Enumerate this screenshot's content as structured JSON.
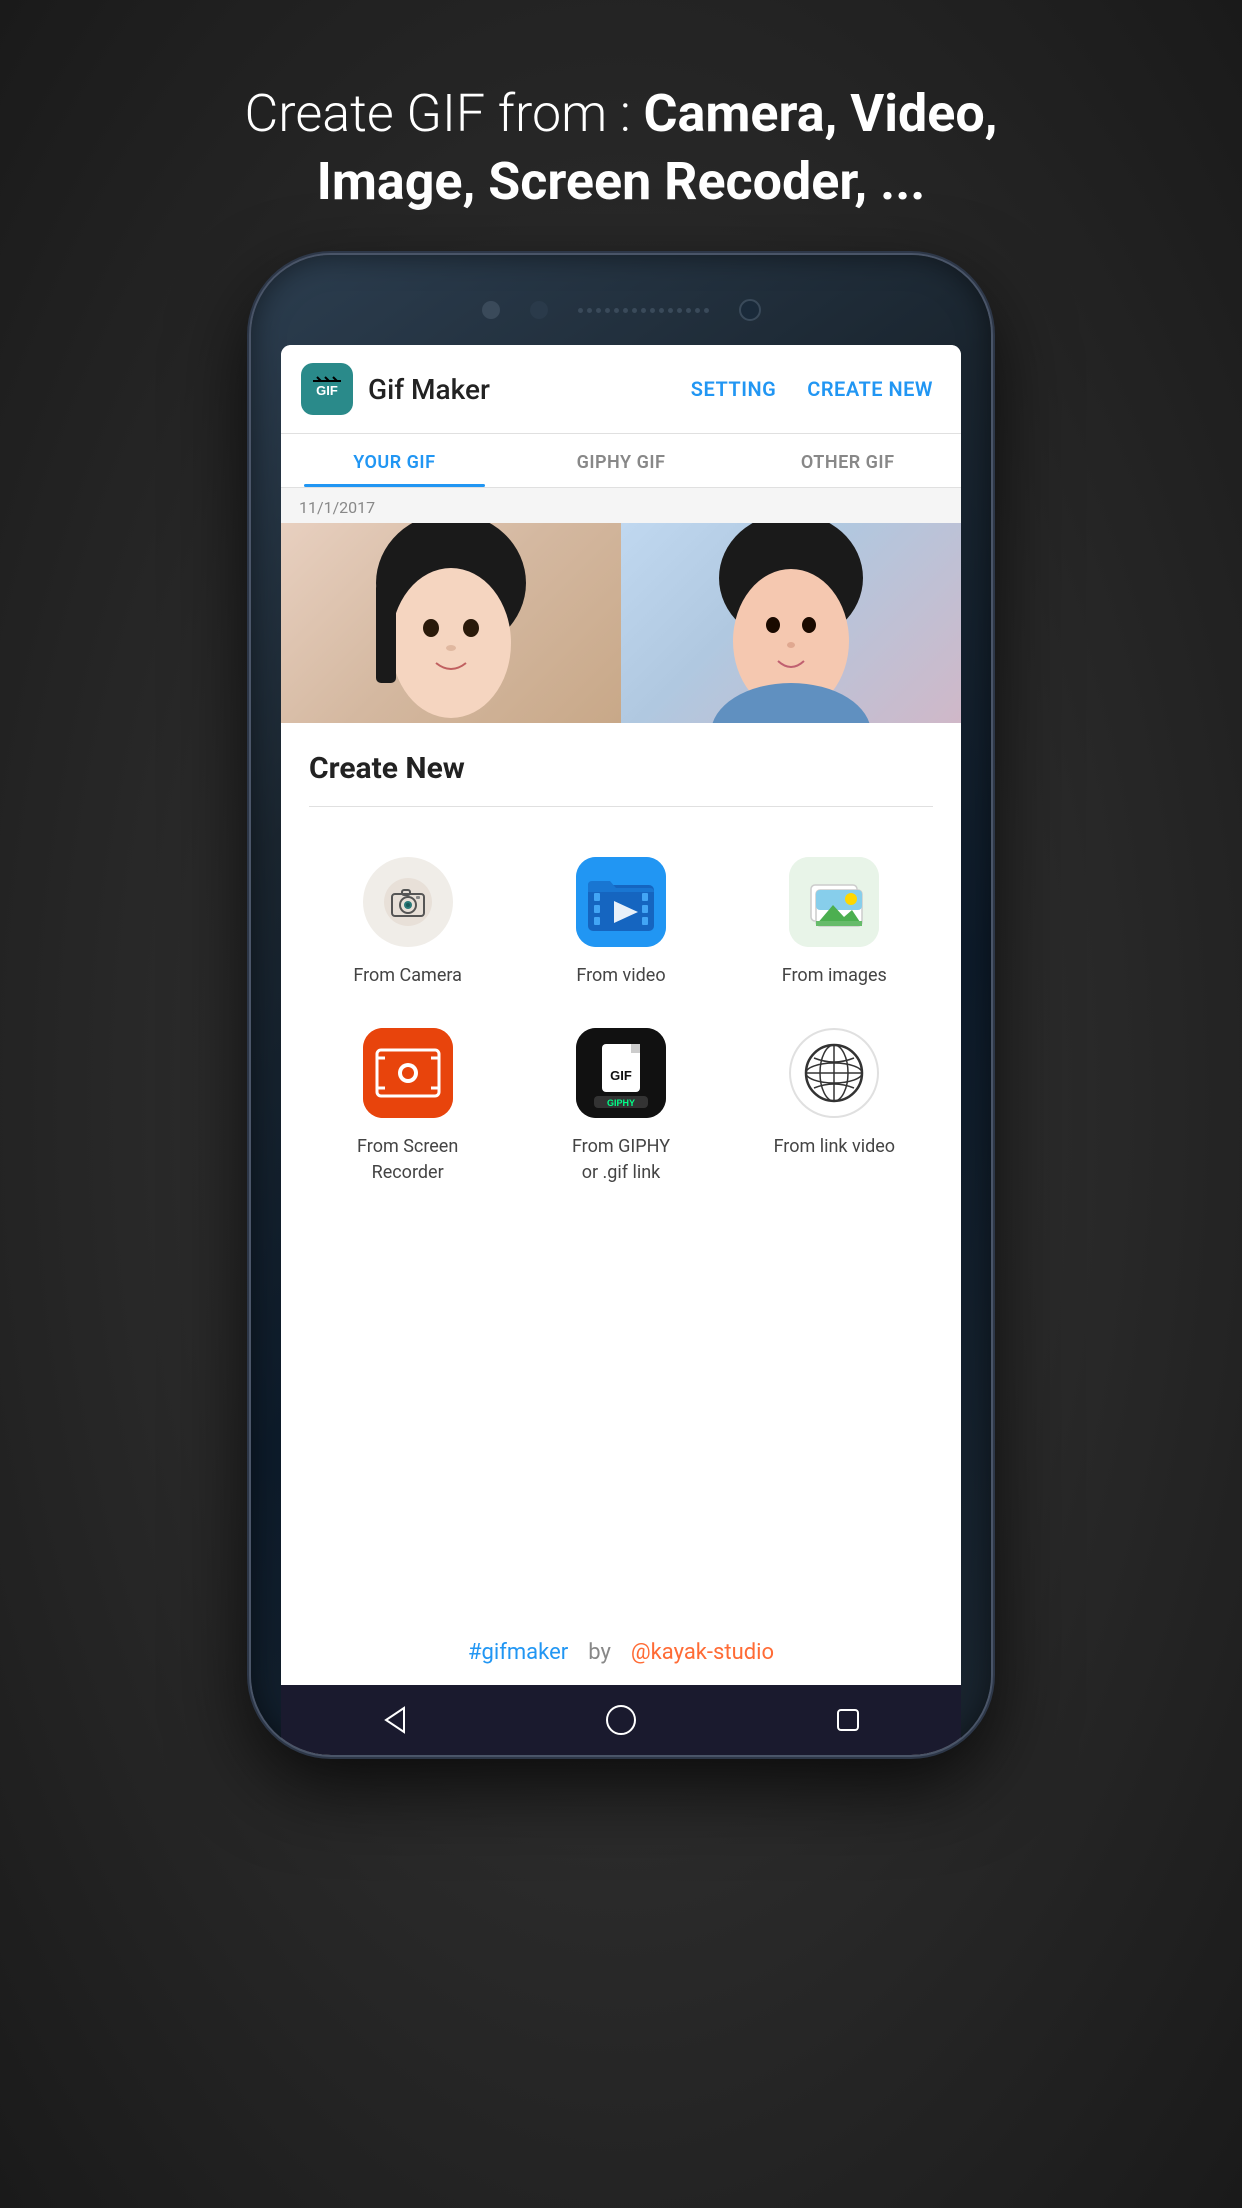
{
  "headline": {
    "part1": "Create GIF from : ",
    "part2": "Camera, Video,",
    "part3": "Image, Screen Recoder, ..."
  },
  "app": {
    "icon_text": "GIF",
    "title": "Gif Maker",
    "setting_btn": "SETTING",
    "create_new_btn": "CREATE NEW",
    "tabs": [
      {
        "label": "YOUR GIF",
        "active": true
      },
      {
        "label": "GIPHY GIF",
        "active": false
      },
      {
        "label": "OTHER GIF",
        "active": false
      }
    ],
    "date_label": "11/1/2017"
  },
  "bottom_sheet": {
    "title": "Create New",
    "items": [
      {
        "id": "camera",
        "label": "From Camera"
      },
      {
        "id": "video",
        "label": "From video"
      },
      {
        "id": "images",
        "label": "From images"
      },
      {
        "id": "screen-recorder",
        "label": "From Screen\nRecorder"
      },
      {
        "id": "giphy",
        "label": "From GIPHY\nor .gif link"
      },
      {
        "id": "link-video",
        "label": "From link video"
      }
    ]
  },
  "footer": {
    "hashtag": "#gifmaker",
    "by": "by",
    "studio": "@kayak-studio"
  },
  "nav": {
    "back_label": "back",
    "home_label": "home",
    "recent_label": "recent"
  }
}
